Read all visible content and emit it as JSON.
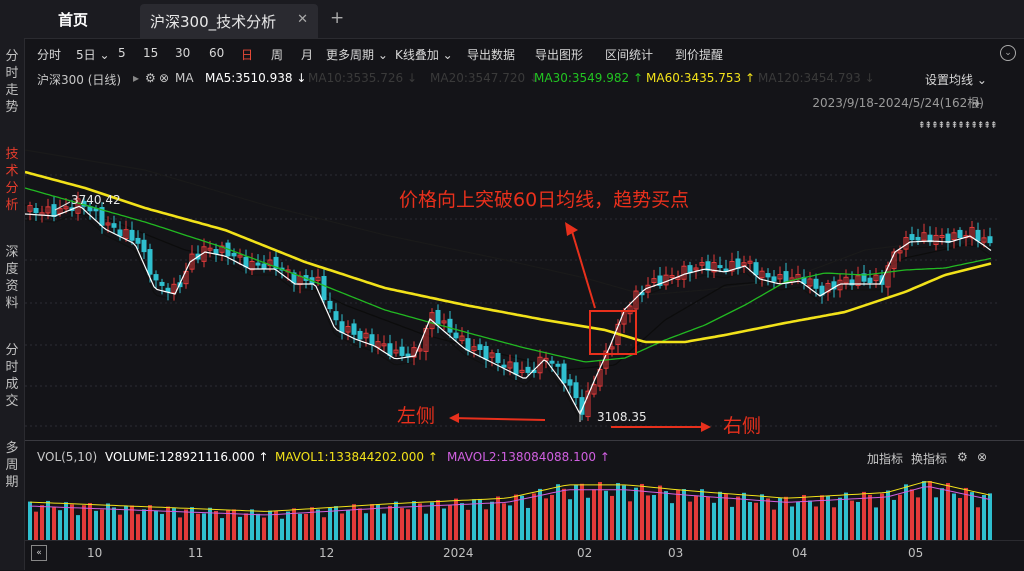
{
  "tabs": {
    "home": "首页",
    "active": "沪深300_技术分析",
    "close": "✕",
    "add": "+"
  },
  "sidebar": [
    {
      "label": "分时走势",
      "active": false
    },
    {
      "label": "技术分析",
      "active": true
    },
    {
      "label": "深度资料",
      "active": false
    },
    {
      "label": "分时成交",
      "active": false
    },
    {
      "label": "多周期",
      "active": false
    }
  ],
  "toolbar": [
    "分时",
    "5日 ⌄",
    "5",
    "15",
    "30",
    "60",
    "日",
    "周",
    "月",
    "更多周期 ⌄",
    "K线叠加 ⌄",
    "导出数据",
    "导出图形",
    "区间统计",
    "到价提醒"
  ],
  "toolbar_active": "日",
  "ma": {
    "name": "沪深300 (日线)",
    "ma_label": "MA",
    "ma5": "MA5:3510.938 ↓",
    "ma10": "MA10:3535.726 ↓",
    "ma20": "MA20:3547.720 ↓",
    "ma30": "MA30:3549.982 ↑",
    "ma60": "MA60:3435.753 ↑",
    "ma120": "MA120:3454.793 ↓",
    "settings": "设置均线 ⌄"
  },
  "range": "2023/9/18-2024/5/24(162根)",
  "hashes": "⇞⇞⇞⇞⇞⇞⇞⇞⇞⇞⇞⇞",
  "annotations": {
    "high": "3740.42",
    "low": "3108.35",
    "callout": "价格向上突破60日均线，趋势买点",
    "left": "左侧",
    "right": "右侧"
  },
  "volume": {
    "title": "VOL(5,10)",
    "volume": "VOLUME:128921116.000 ↑",
    "mavol1": "MAVOL1:133844202.000 ↑",
    "mavol2": "MAVOL2:138084088.100 ↑",
    "add_indicator": "加指标",
    "switch_indicator": "换指标"
  },
  "xaxis": [
    "10",
    "11",
    "12",
    "2024",
    "02",
    "03",
    "04",
    "05"
  ],
  "colors": {
    "up": "#e23a3a",
    "down": "#2fbfcf",
    "ma5": "#ffffff",
    "ma10": "#101010",
    "ma30": "#22b922",
    "ma60": "#f2e21a",
    "ma120": "#1a1a1a",
    "annotation": "#e8301c",
    "active": "#e94a38"
  },
  "chart_data": {
    "type": "candlestick",
    "series_description": "daily price 2023/9/18-2024/5/24",
    "key_points": [
      {
        "label": "3740.42",
        "value": 3740.42
      },
      {
        "label": "3108.35",
        "value": 3108.35
      }
    ]
  }
}
